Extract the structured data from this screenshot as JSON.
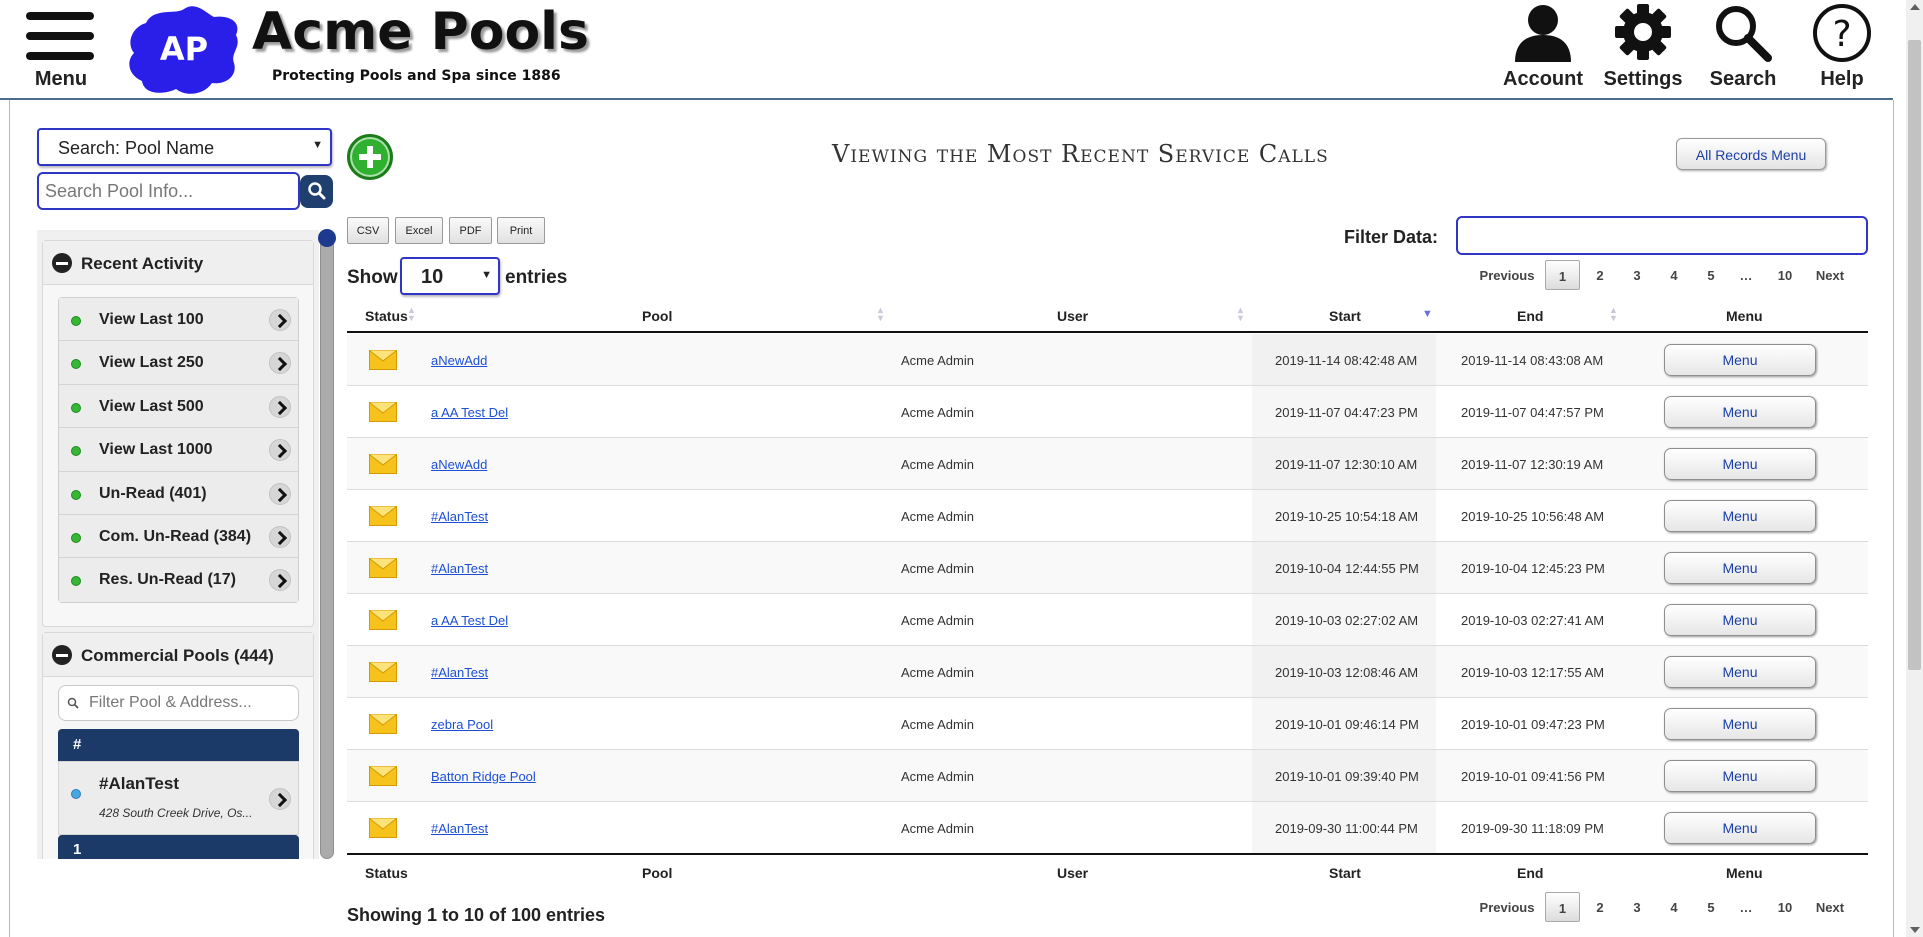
{
  "header": {
    "menu_label": "Menu",
    "logo_initials": "AP",
    "brand_name": "Acme Pools",
    "tagline": "Protecting Pools and Spa since 1886",
    "account_label": "Account",
    "settings_label": "Settings",
    "search_label": "Search",
    "help_label": "Help"
  },
  "sidebar": {
    "search_type": "Search: Pool Name",
    "search_placeholder": "Search Pool Info...",
    "recent_activity": {
      "title": "Recent Activity",
      "items": [
        {
          "label": "View Last 100"
        },
        {
          "label": "View Last 250"
        },
        {
          "label": "View Last 500"
        },
        {
          "label": "View Last 1000"
        },
        {
          "label": "Un-Read (401)"
        },
        {
          "label": "Com. Un-Read (384)"
        },
        {
          "label": "Res. Un-Read (17)"
        }
      ]
    },
    "commercial_pools": {
      "title": "Commercial Pools (444)",
      "filter_placeholder": "Filter Pool & Address...",
      "group_header": "#",
      "next_group_header": "1",
      "pool": {
        "name": "#AlanTest",
        "address": "428 South Creek Drive, Os..."
      }
    }
  },
  "main": {
    "title": "Viewing the Most Recent Service Calls",
    "all_records_label": "All Records Menu",
    "export_buttons": [
      "CSV",
      "Excel",
      "PDF",
      "Print"
    ],
    "filter_label": "Filter Data:",
    "filter_value": "",
    "show_label": "Show",
    "entries_value": "10",
    "entries_label": "entries",
    "pagination": {
      "previous": "Previous",
      "pages": [
        "1",
        "2",
        "3",
        "4",
        "5",
        "…",
        "10"
      ],
      "next": "Next",
      "current": "1"
    },
    "columns": [
      "Status",
      "Pool",
      "User",
      "Start",
      "End",
      "Menu"
    ],
    "sorted_column": "Start",
    "rows": [
      {
        "pool": "aNewAdd",
        "user": "Acme Admin",
        "start": "2019-11-14 08:42:48 AM",
        "end": "2019-11-14 08:43:08 AM",
        "menu": "Menu"
      },
      {
        "pool": "a AA Test Del",
        "user": "Acme Admin",
        "start": "2019-11-07 04:47:23 PM",
        "end": "2019-11-07 04:47:57 PM",
        "menu": "Menu"
      },
      {
        "pool": "aNewAdd",
        "user": "Acme Admin",
        "start": "2019-11-07 12:30:10 AM",
        "end": "2019-11-07 12:30:19 AM",
        "menu": "Menu"
      },
      {
        "pool": "#AlanTest",
        "user": "Acme Admin",
        "start": "2019-10-25 10:54:18 AM",
        "end": "2019-10-25 10:56:48 AM",
        "menu": "Menu"
      },
      {
        "pool": "#AlanTest",
        "user": "Acme Admin",
        "start": "2019-10-04 12:44:55 PM",
        "end": "2019-10-04 12:45:23 PM",
        "menu": "Menu"
      },
      {
        "pool": "a AA Test Del",
        "user": "Acme Admin",
        "start": "2019-10-03 02:27:02 AM",
        "end": "2019-10-03 02:27:41 AM",
        "menu": "Menu"
      },
      {
        "pool": "#AlanTest",
        "user": "Acme Admin",
        "start": "2019-10-03 12:08:46 AM",
        "end": "2019-10-03 12:17:55 AM",
        "menu": "Menu"
      },
      {
        "pool": "zebra Pool",
        "user": "Acme Admin",
        "start": "2019-10-01 09:46:14 PM",
        "end": "2019-10-01 09:47:23 PM",
        "menu": "Menu"
      },
      {
        "pool": "Batton Ridge Pool",
        "user": "Acme Admin",
        "start": "2019-10-01 09:39:40 PM",
        "end": "2019-10-01 09:41:56 PM",
        "menu": "Menu"
      },
      {
        "pool": "#AlanTest",
        "user": "Acme Admin",
        "start": "2019-09-30 11:00:44 PM",
        "end": "2019-09-30 11:18:09 PM",
        "menu": "Menu"
      }
    ],
    "showing_text": "Showing 1 to 10 of 100 entries"
  },
  "colors": {
    "brand_blue": "#1f3f6f",
    "link_blue": "#1c4fd6",
    "logo_blob": "#2a1fe8",
    "add_green": "#30b030",
    "envelope_yellow": "#f6c21c"
  },
  "icons": {
    "menu": "hamburger-icon",
    "account": "person-icon",
    "settings": "gear-icon",
    "search": "magnifier-icon",
    "help": "question-circle-icon",
    "status": "envelope-icon"
  }
}
